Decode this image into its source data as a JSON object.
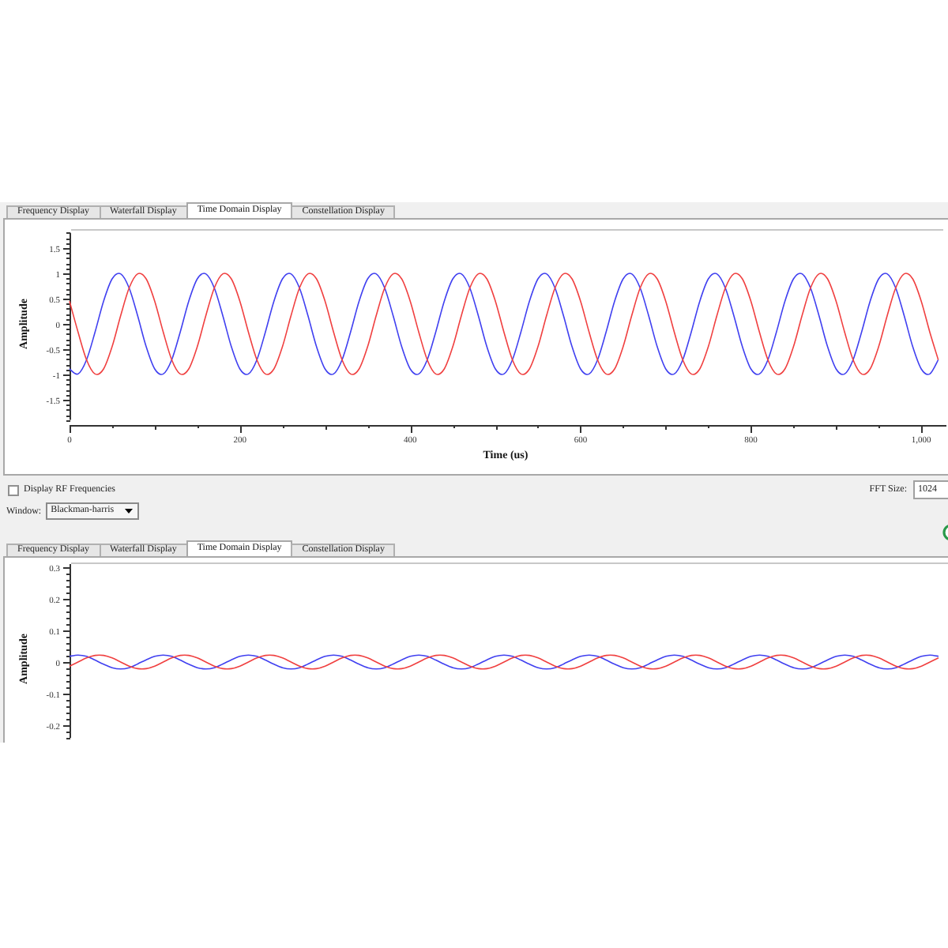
{
  "top_panel": {
    "tabs": [
      {
        "label": "Frequency Display",
        "selected": false
      },
      {
        "label": "Waterfall Display",
        "selected": false
      },
      {
        "label": "Time Domain Display",
        "selected": true
      },
      {
        "label": "Constellation Display",
        "selected": false
      }
    ],
    "chart_data": {
      "type": "line",
      "xlabel": "Time (us)",
      "ylabel": "Amplitude",
      "xlim": [
        0,
        1024
      ],
      "ylim": [
        -1.9,
        1.8
      ],
      "xticks": [
        0,
        200,
        400,
        600,
        800,
        {
          "value": 1000,
          "label": "1,000"
        }
      ],
      "yticks": [
        -1.5,
        -1,
        -0.5,
        0,
        0.5,
        1,
        1.5
      ],
      "x": [
        0,
        10,
        20,
        30,
        40,
        50,
        60,
        70,
        80,
        90,
        100,
        110,
        120,
        130,
        140,
        150,
        160,
        170,
        180,
        190,
        200,
        210,
        220,
        230,
        240,
        250,
        260,
        270,
        280,
        290,
        300,
        310,
        320,
        330,
        340,
        350,
        360,
        370,
        380,
        390,
        400,
        410,
        420,
        430,
        440,
        450,
        460,
        470,
        480,
        490,
        500,
        510,
        520,
        530,
        540,
        550,
        560,
        570,
        580,
        590,
        600,
        610,
        620,
        630,
        640,
        650,
        660,
        670,
        680,
        690,
        700,
        710,
        720,
        730,
        740,
        750,
        760,
        770,
        780,
        790,
        800,
        810,
        820,
        830,
        840,
        850,
        860,
        870,
        880,
        890,
        900,
        910,
        920,
        930,
        940,
        950,
        960,
        970,
        980,
        990,
        1000,
        1010,
        1020
      ],
      "series": [
        {
          "color": "#4040f0",
          "values": [
            -0.89,
            -0.99,
            -0.71,
            -0.16,
            0.45,
            0.89,
            0.99,
            0.71,
            0.16,
            -0.45,
            -0.89,
            -0.99,
            -0.71,
            -0.16,
            0.45,
            0.89,
            0.99,
            0.71,
            0.16,
            -0.45,
            -0.89,
            -0.99,
            -0.71,
            -0.16,
            0.45,
            0.89,
            0.99,
            0.71,
            0.16,
            -0.45,
            -0.89,
            -0.99,
            -0.71,
            -0.16,
            0.45,
            0.89,
            0.99,
            0.71,
            0.16,
            -0.45,
            -0.89,
            -0.99,
            -0.71,
            -0.16,
            0.45,
            0.89,
            0.99,
            0.71,
            0.16,
            -0.45,
            -0.89,
            -0.99,
            -0.71,
            -0.16,
            0.45,
            0.89,
            0.99,
            0.71,
            0.16,
            -0.45,
            -0.89,
            -0.99,
            -0.71,
            -0.16,
            0.45,
            0.89,
            0.99,
            0.71,
            0.16,
            -0.45,
            -0.89,
            -0.99,
            -0.71,
            -0.16,
            0.45,
            0.89,
            0.99,
            0.71,
            0.16,
            -0.45,
            -0.89,
            -0.99,
            -0.71,
            -0.16,
            0.45,
            0.89,
            0.99,
            0.71,
            0.16,
            -0.45,
            -0.89,
            -0.99,
            -0.71,
            -0.16,
            0.45,
            0.89,
            0.99,
            0.71,
            0.16,
            -0.45,
            -0.89,
            -0.99,
            -0.71
          ]
        },
        {
          "color": "#f04040",
          "values": [
            0.45,
            -0.16,
            -0.71,
            -0.99,
            -0.89,
            -0.45,
            0.16,
            0.71,
            0.99,
            0.89,
            0.45,
            -0.16,
            -0.71,
            -0.99,
            -0.89,
            -0.45,
            0.16,
            0.71,
            0.99,
            0.89,
            0.45,
            -0.16,
            -0.71,
            -0.99,
            -0.89,
            -0.45,
            0.16,
            0.71,
            0.99,
            0.89,
            0.45,
            -0.16,
            -0.71,
            -0.99,
            -0.89,
            -0.45,
            0.16,
            0.71,
            0.99,
            0.89,
            0.45,
            -0.16,
            -0.71,
            -0.99,
            -0.89,
            -0.45,
            0.16,
            0.71,
            0.99,
            0.89,
            0.45,
            -0.16,
            -0.71,
            -0.99,
            -0.89,
            -0.45,
            0.16,
            0.71,
            0.99,
            0.89,
            0.45,
            -0.16,
            -0.71,
            -0.99,
            -0.89,
            -0.45,
            0.16,
            0.71,
            0.99,
            0.89,
            0.45,
            -0.16,
            -0.71,
            -0.99,
            -0.89,
            -0.45,
            0.16,
            0.71,
            0.99,
            0.89,
            0.45,
            -0.16,
            -0.71,
            -0.99,
            -0.89,
            -0.45,
            0.16,
            0.71,
            0.99,
            0.89,
            0.45,
            -0.16,
            -0.71,
            -0.99,
            -0.89,
            -0.45,
            0.16,
            0.71,
            0.99,
            0.89,
            0.45,
            -0.16,
            -0.71
          ]
        }
      ]
    }
  },
  "controls": {
    "display_rf_frequencies": {
      "label": "Display RF Frequencies",
      "checked": false
    },
    "fft_size": {
      "label": "FFT Size:",
      "value": "1024"
    },
    "window": {
      "label": "Window:",
      "value": "Blackman-harris"
    }
  },
  "bottom_panel": {
    "tabs": [
      {
        "label": "Frequency Display",
        "selected": false
      },
      {
        "label": "Waterfall Display",
        "selected": false
      },
      {
        "label": "Time Domain Display",
        "selected": true
      },
      {
        "label": "Constellation Display",
        "selected": false
      }
    ],
    "chart_data": {
      "type": "line",
      "ylabel": "Amplitude",
      "ylim": [
        -0.24,
        0.31
      ],
      "yticks": [
        -0.2,
        -0.1,
        0,
        0.1,
        0.2,
        0.3
      ],
      "series": [
        {
          "color": "#4040f0",
          "values": [
            0.018,
            0.022,
            0.018,
            0.006,
            -0.007,
            -0.018,
            -0.022,
            -0.018,
            -0.006,
            0.007,
            0.018,
            0.022,
            0.018,
            0.006,
            -0.007,
            -0.018,
            -0.022,
            -0.018,
            -0.006,
            0.007,
            0.018,
            0.022,
            0.018,
            0.006,
            -0.007,
            -0.018,
            -0.022,
            -0.018,
            -0.006,
            0.007,
            0.018,
            0.022,
            0.018,
            0.006,
            -0.007,
            -0.018,
            -0.022,
            -0.018,
            -0.006,
            0.007,
            0.018,
            0.022,
            0.018,
            0.006,
            -0.007,
            -0.018,
            -0.022,
            -0.018,
            -0.006,
            0.007,
            0.018,
            0.022,
            0.018,
            0.006,
            -0.007,
            -0.018,
            -0.022,
            -0.018,
            -0.006,
            0.007,
            0.018,
            0.022,
            0.018,
            0.006,
            -0.007,
            -0.018,
            -0.022,
            -0.018,
            -0.006,
            0.007,
            0.018,
            0.022,
            0.018,
            0.006,
            -0.007,
            -0.018,
            -0.022,
            -0.018,
            -0.006,
            0.007,
            0.018,
            0.022,
            0.018,
            0.006,
            -0.007,
            -0.018,
            -0.022,
            -0.018,
            -0.006,
            0.007,
            0.018,
            0.022,
            0.018,
            0.006,
            -0.007,
            -0.018,
            -0.022,
            -0.018,
            -0.006,
            0.007,
            0.018,
            0.022,
            0.018
          ]
        },
        {
          "color": "#f04040",
          "values": [
            -0.013,
            0,
            0.013,
            0.021,
            0.021,
            0.013,
            0,
            -0.013,
            -0.021,
            -0.021,
            -0.013,
            0,
            0.013,
            0.021,
            0.021,
            0.013,
            0,
            -0.013,
            -0.021,
            -0.021,
            -0.013,
            0,
            0.013,
            0.021,
            0.021,
            0.013,
            0,
            -0.013,
            -0.021,
            -0.021,
            -0.013,
            0,
            0.013,
            0.021,
            0.021,
            0.013,
            0,
            -0.013,
            -0.021,
            -0.021,
            -0.013,
            0,
            0.013,
            0.021,
            0.021,
            0.013,
            0,
            -0.013,
            -0.021,
            -0.021,
            -0.013,
            0,
            0.013,
            0.021,
            0.021,
            0.013,
            0,
            -0.013,
            -0.021,
            -0.021,
            -0.013,
            0,
            0.013,
            0.021,
            0.021,
            0.013,
            0,
            -0.013,
            -0.021,
            -0.021,
            -0.013,
            0,
            0.013,
            0.021,
            0.021,
            0.013,
            0,
            -0.013,
            -0.021,
            -0.021,
            -0.013,
            0,
            0.013,
            0.021,
            0.021,
            0.013,
            0,
            -0.013,
            -0.021,
            -0.021,
            -0.013,
            0,
            0.013,
            0.021,
            0.021,
            0.013,
            0,
            -0.013,
            -0.021,
            -0.021,
            -0.013,
            0,
            0.013
          ]
        }
      ]
    }
  }
}
